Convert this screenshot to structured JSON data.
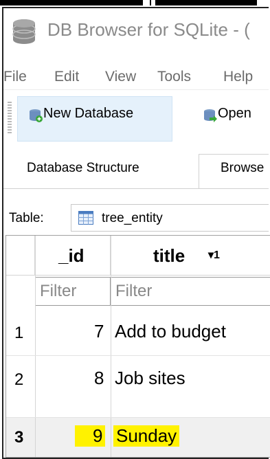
{
  "window": {
    "title": "DB Browser for SQLite - ("
  },
  "menu": [
    "File",
    "Edit",
    "View",
    "Tools",
    "Help"
  ],
  "toolbar": {
    "new_database": "New Database",
    "open": "Open"
  },
  "tabs": [
    "Database Structure",
    "Browse"
  ],
  "table_select": {
    "label": "Table:",
    "value": "tree_entity"
  },
  "grid": {
    "columns": [
      "_id",
      "title"
    ],
    "sort_indicator": "▾1",
    "filter_placeholder": "Filter",
    "rows": [
      {
        "num": "1",
        "id": "7",
        "title": "Add to budget"
      },
      {
        "num": "2",
        "id": "8",
        "title": "Job sites"
      },
      {
        "num": "3",
        "id": "9",
        "title": "Sunday"
      }
    ]
  },
  "colors": {
    "highlight": "#fff200",
    "button_bg": "#e5f1fb"
  }
}
